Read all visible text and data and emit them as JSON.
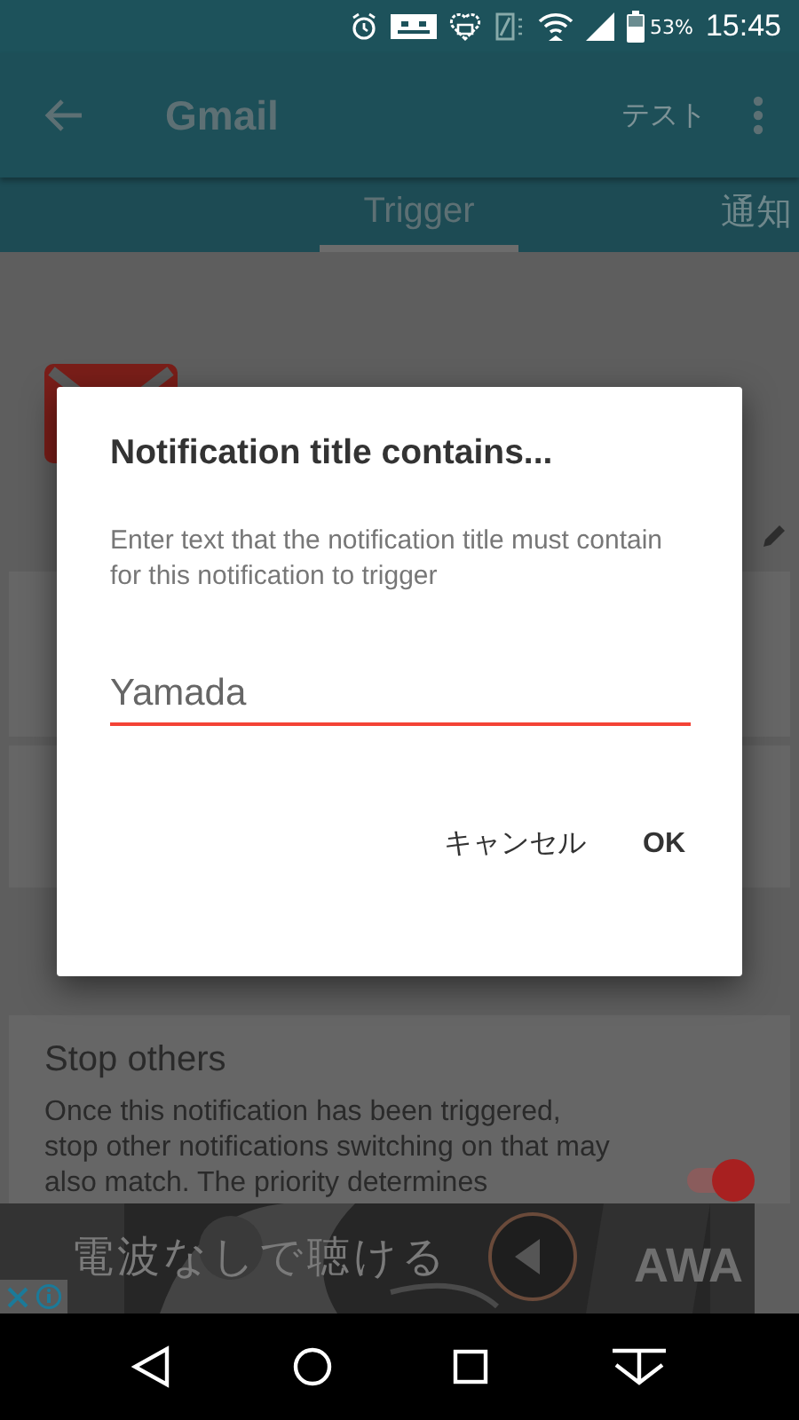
{
  "status_bar": {
    "battery": "53%",
    "time": "15:45"
  },
  "app_bar": {
    "title": "Gmail",
    "action": "テスト"
  },
  "tabs": [
    {
      "label": "Trigger",
      "selected": true
    },
    {
      "label": "通知",
      "selected": false
    }
  ],
  "stop_others": {
    "title": "Stop others",
    "description": "Once this notification has been triggered, stop other notifications switching on that may also match. The priority determines",
    "on": true
  },
  "ad": {
    "headline": "電波なしで聴ける",
    "brand": "AWA"
  },
  "dialog": {
    "title": "Notification title contains...",
    "message": "Enter text that the notification title must contain for this notification to trigger",
    "field": {
      "value": "Yamada"
    },
    "buttons": [
      "キャンセル",
      "OK"
    ]
  }
}
